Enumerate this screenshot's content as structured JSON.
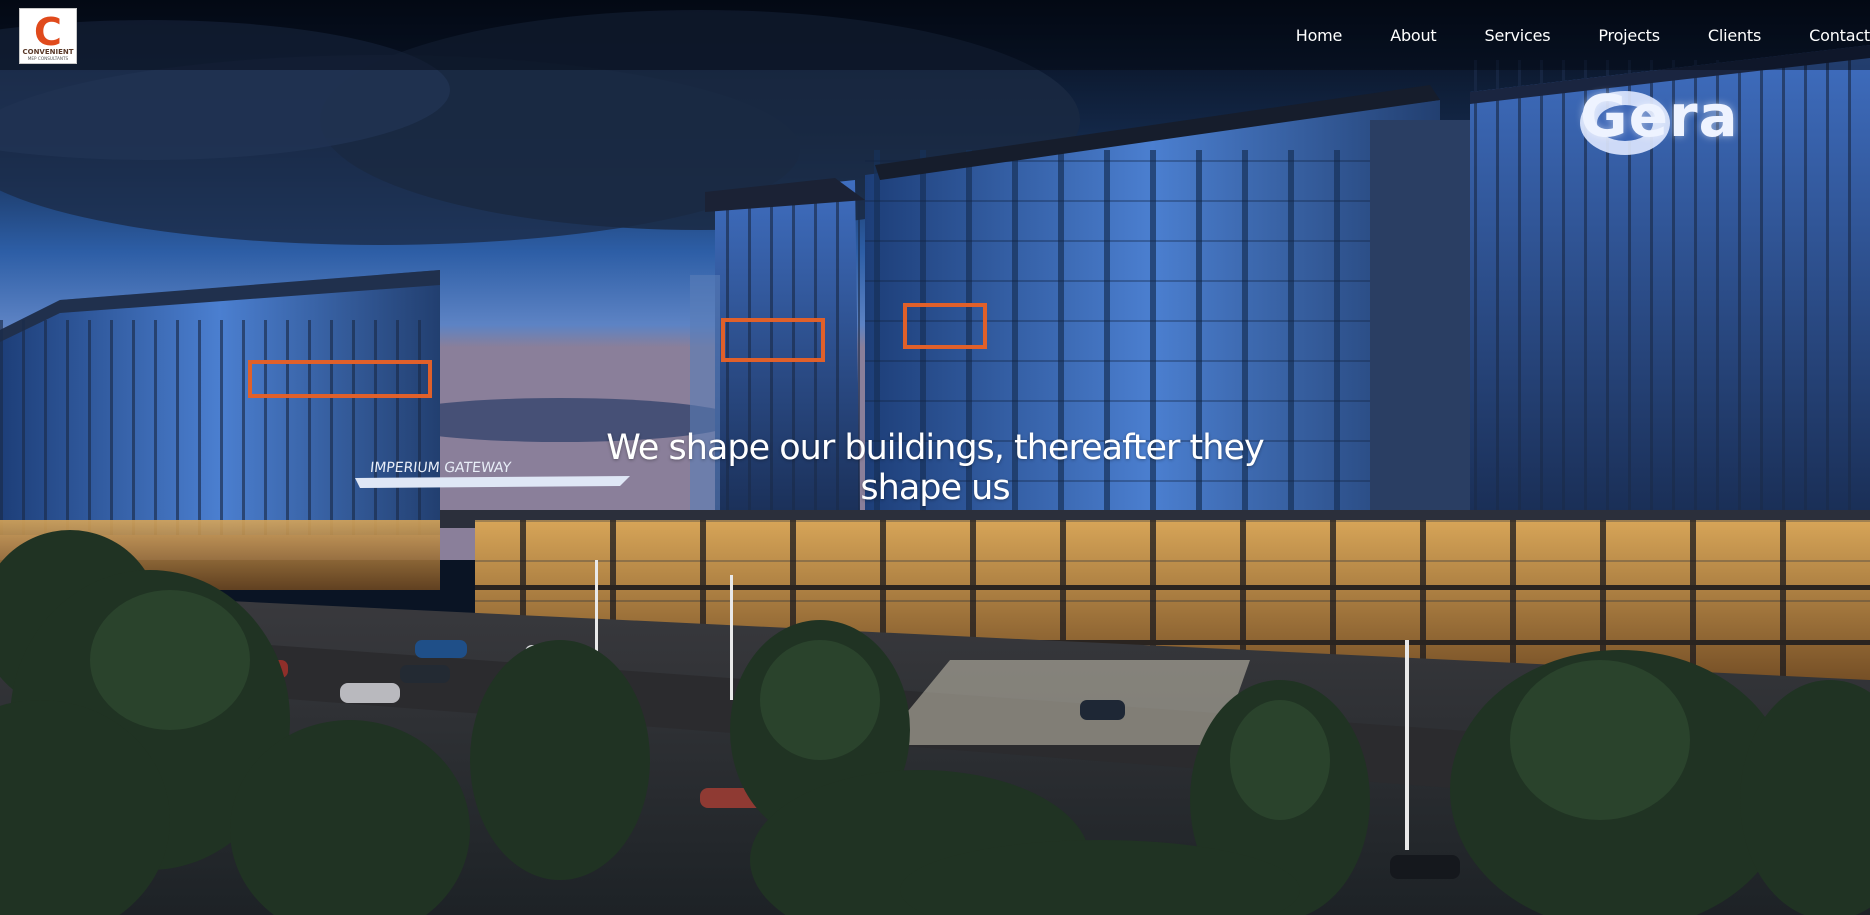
{
  "header": {
    "logo": {
      "letter": "C",
      "name": "CONVENIENT",
      "tagline": "MEP CONSULTANTS"
    },
    "nav": [
      {
        "label": "Home"
      },
      {
        "label": "About"
      },
      {
        "label": "Services"
      },
      {
        "label": "Projects"
      },
      {
        "label": "Clients"
      },
      {
        "label": "Contact"
      }
    ]
  },
  "hero": {
    "caption_line1": "We shape our buildings, thereafter they",
    "caption_line2": "shape us",
    "building_sign": "Gera",
    "gateway_sign": "IMPERIUM GATEWAY"
  },
  "colors": {
    "logo_red": "#e04a1c",
    "sky_dark": "#0b1a33",
    "glass_blue": "#2f5fa8"
  }
}
